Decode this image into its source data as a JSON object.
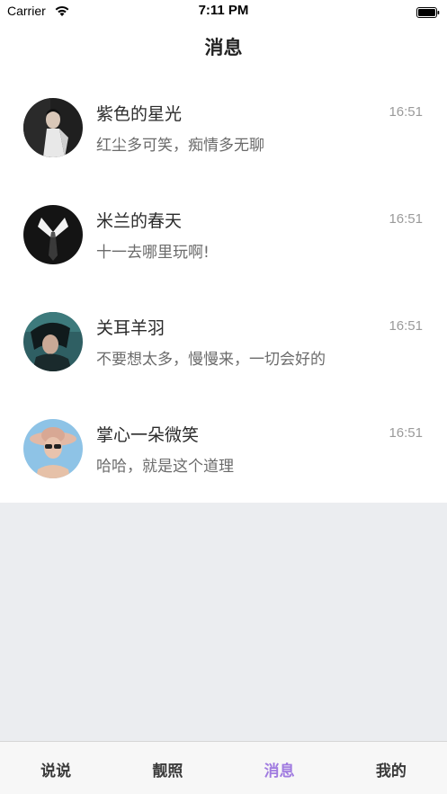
{
  "status_bar": {
    "carrier": "Carrier",
    "time": "7:11 PM"
  },
  "nav": {
    "title": "消息"
  },
  "messages": [
    {
      "name": "紫色的星光",
      "time": "16:51",
      "preview": "红尘多可笑，痴情多无聊"
    },
    {
      "name": "米兰的春天",
      "time": "16:51",
      "preview": "十一去哪里玩啊!"
    },
    {
      "name": "关耳羊羽",
      "time": "16:51",
      "preview": "不要想太多，慢慢来，一切会好的"
    },
    {
      "name": "掌心一朵微笑",
      "time": "16:51",
      "preview": "哈哈，就是这个道理"
    }
  ],
  "tabs": [
    {
      "label": "说说"
    },
    {
      "label": "靓照"
    },
    {
      "label": "消息"
    },
    {
      "label": "我的"
    }
  ],
  "colors": {
    "accent": "#a07be0",
    "background": "#ebedf0"
  }
}
